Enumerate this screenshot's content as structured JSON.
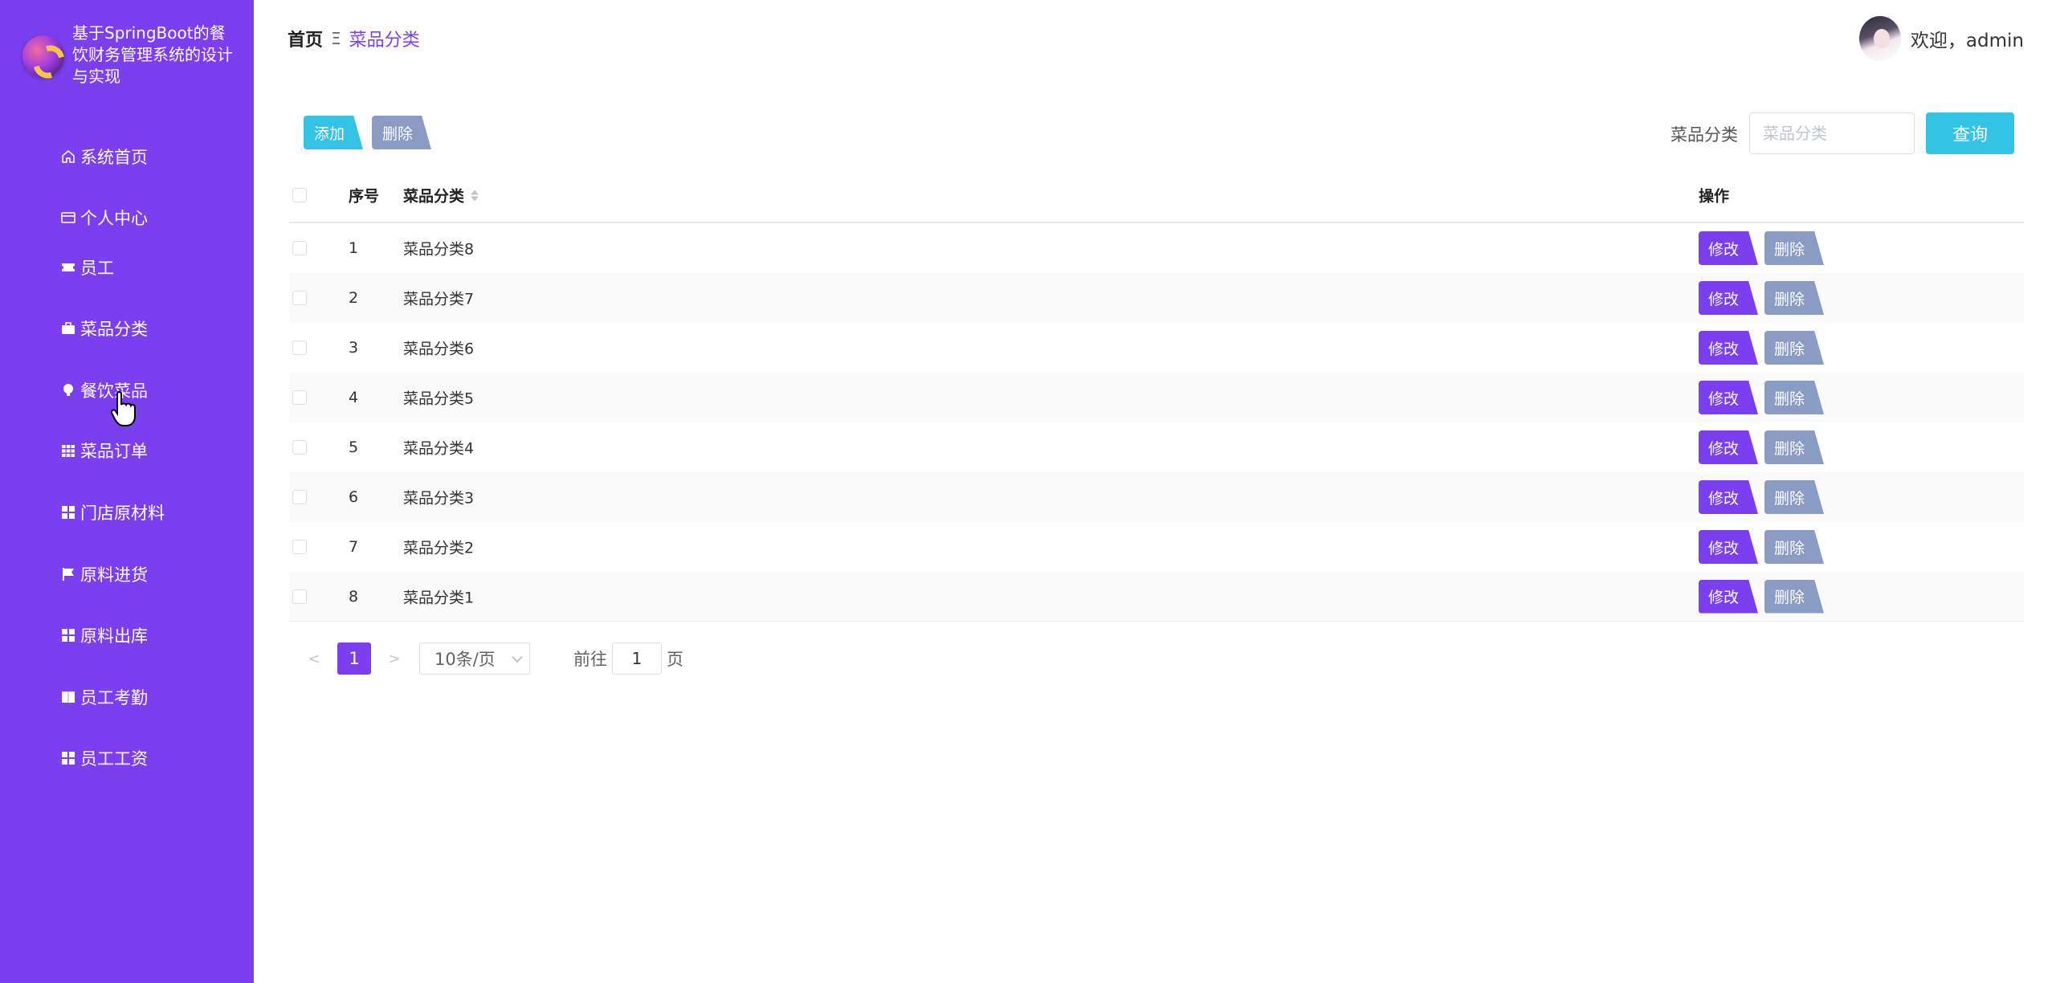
{
  "brand": {
    "title": "基于SpringBoot的餐饮财务管理系统的设计与实现"
  },
  "sidebar": {
    "items": [
      {
        "label": "系统首页",
        "icon": "home-icon"
      },
      {
        "label": "个人中心",
        "icon": "id-card-icon"
      },
      {
        "label": "员工",
        "icon": "ticket-icon"
      },
      {
        "label": "菜品分类",
        "icon": "briefcase-icon"
      },
      {
        "label": "餐饮菜品",
        "icon": "bulb-icon"
      },
      {
        "label": "菜品订单",
        "icon": "grid-icon"
      },
      {
        "label": "门店原材料",
        "icon": "apps-icon"
      },
      {
        "label": "原料进货",
        "icon": "flag-icon"
      },
      {
        "label": "原料出库",
        "icon": "apps-icon"
      },
      {
        "label": "员工考勤",
        "icon": "book-icon"
      },
      {
        "label": "员工工资",
        "icon": "apps-icon"
      }
    ]
  },
  "header": {
    "breadcrumb_home": "首页",
    "breadcrumb_sep": "Ξ",
    "breadcrumb_current": "菜品分类",
    "welcome": "欢迎，admin"
  },
  "toolbar": {
    "add_label": "添加",
    "delete_label": "删除",
    "search_label": "菜品分类",
    "search_placeholder": "菜品分类",
    "query_label": "查询"
  },
  "table": {
    "columns": {
      "index": "序号",
      "name": "菜品分类",
      "ops": "操作"
    },
    "edit_label": "修改",
    "delete_label": "删除",
    "rows": [
      {
        "index": "1",
        "name": "菜品分类8"
      },
      {
        "index": "2",
        "name": "菜品分类7"
      },
      {
        "index": "3",
        "name": "菜品分类6"
      },
      {
        "index": "4",
        "name": "菜品分类5"
      },
      {
        "index": "5",
        "name": "菜品分类4"
      },
      {
        "index": "6",
        "name": "菜品分类3"
      },
      {
        "index": "7",
        "name": "菜品分类2"
      },
      {
        "index": "8",
        "name": "菜品分类1"
      }
    ]
  },
  "pagination": {
    "prev": "<",
    "current": "1",
    "next": ">",
    "page_size": "10条/页",
    "goto_prefix": "前往",
    "goto_value": "1",
    "goto_suffix": "页"
  },
  "colors": {
    "accent": "#7b3fef",
    "cyan": "#34c3e4",
    "grey_btn": "#8a9cc4"
  }
}
